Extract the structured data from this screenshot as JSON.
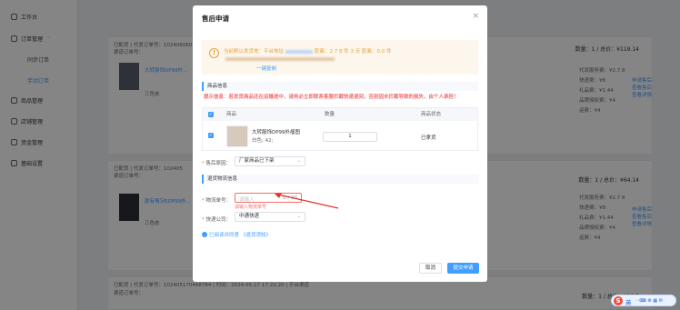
{
  "sidebar": {
    "workbench": "工作台",
    "order_mgmt": "订单管理",
    "sync_orders": "同步订单",
    "manual_orders": "手动订单",
    "goods_mgmt": "商品管理",
    "store_mgmt": "店铺管理",
    "finance_mgmt": "资金管理",
    "basic_settings": "基础设置"
  },
  "background": {
    "order1": {
      "head": "已配货 | 代发订单号：102406060",
      "sub": "渠道订单号：",
      "totals": "数量：1 / 总价：¥119.14",
      "product": "大转服饰DP99外...",
      "color": "三色衣",
      "labels": [
        "代发服务费：¥2.7 8",
        "快递费：¥8",
        "礼品费：¥1.44",
        "品牌授权费：¥4",
        "运费：¥4"
      ],
      "links": [
        "申请售后",
        "查看售后",
        "查看详情"
      ]
    },
    "order2": {
      "head": "已配货 | 代发订单号：102405",
      "sub": "渠道订单号：",
      "totals": "数量：1 / 总价：¥64.14",
      "product": "款有情况6DP99外...",
      "color": "三色衣",
      "labels": [
        "代发服务费：¥2.7 8",
        "快递费：¥8",
        "礼品费：¥1.44",
        "品牌授权费：¥4",
        "运费：¥4"
      ],
      "links": [
        "申请售后",
        "查看售后",
        "查看详情"
      ]
    },
    "order3": {
      "head": "已配货 | 代发订单号：102405170468784 | 时间：2024-05-17 17:22:20 | 平台渠道",
      "sub": "渠道订单号：",
      "totals": "数量：1 / 总价：¥98.5"
    }
  },
  "dialog": {
    "title": "售后申请",
    "close": "×",
    "notice_line1": "当前默认发货地：平台地址",
    "notice_line1b": "距离：2.7 8 件 3 天  距离：0.0 件",
    "notice_link": "一键复制",
    "goods_section": "商品信息",
    "warning": "提示信息：若发货商品还在运输途中，请务必立即联系客服拦截快递退回，否则因未拦截导致的损失，由个人承担！",
    "table": {
      "headers": [
        "商品",
        "数量",
        "商品状态"
      ],
      "row": {
        "name": "大转服饰DP99外瘤图",
        "spec": "白色; 42;",
        "quantity": "1",
        "status": "已拿货"
      }
    },
    "reason_label": "售后原因：",
    "reason_value": "厂家商品已下架",
    "return_section": "退货物流信息",
    "tracking_label": "物流单号：",
    "tracking_placeholder": "请输入",
    "tracking_counter": "0 / 30",
    "tracking_error": "请输入物流单号",
    "courier_label": "快递公司：",
    "courier_value": "中通快递",
    "agree_text": "已阅读并同意",
    "agree_link": "《退货须知》",
    "cancel": "取消",
    "submit": "提交申请"
  },
  "ime": {
    "label": "英"
  },
  "colors": {
    "primary": "#409eff",
    "danger": "#f56c6c",
    "warning": "#e6a23c"
  }
}
